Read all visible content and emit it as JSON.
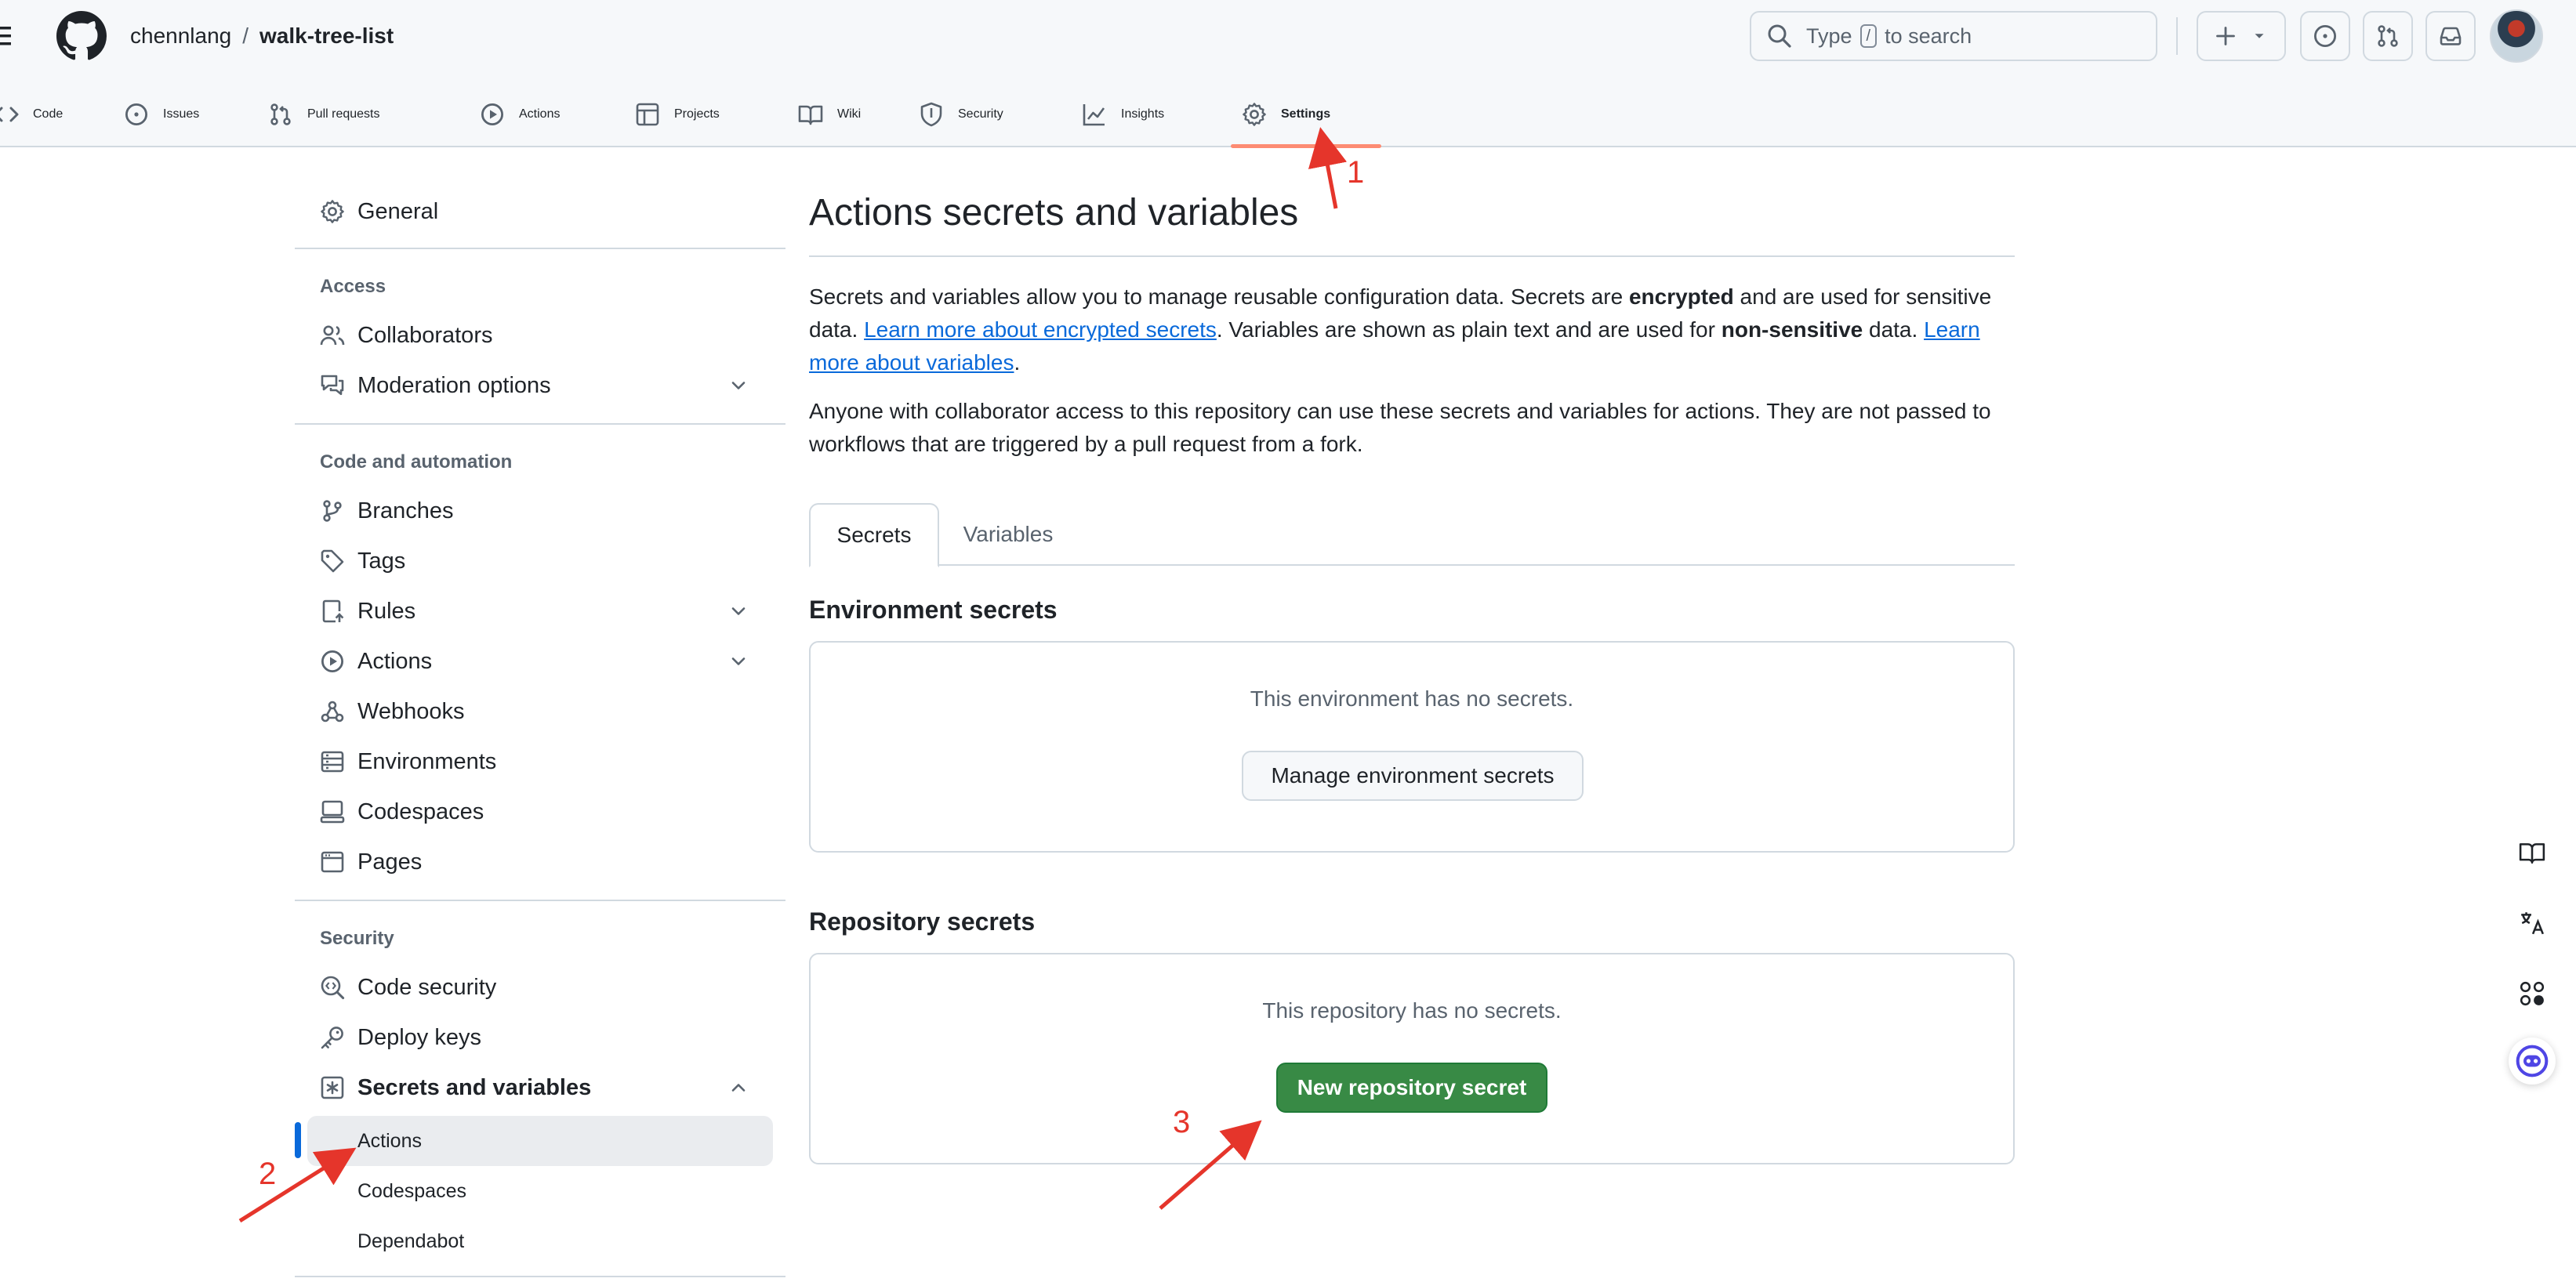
{
  "header": {
    "owner": "chennlang",
    "separator": "/",
    "repo": "walk-tree-list",
    "search": {
      "prefix": "Type",
      "key": "/",
      "suffix": "to search"
    }
  },
  "repo_nav": {
    "items": [
      {
        "label": "Code",
        "icon": "code-icon"
      },
      {
        "label": "Issues",
        "icon": "issue-icon"
      },
      {
        "label": "Pull requests",
        "icon": "pull-request-icon"
      },
      {
        "label": "Actions",
        "icon": "play-icon"
      },
      {
        "label": "Projects",
        "icon": "table-icon"
      },
      {
        "label": "Wiki",
        "icon": "book-icon"
      },
      {
        "label": "Security",
        "icon": "shield-icon"
      },
      {
        "label": "Insights",
        "icon": "graph-icon"
      },
      {
        "label": "Settings",
        "icon": "gear-icon"
      }
    ],
    "active": "Settings"
  },
  "sidebar": {
    "general": "General",
    "access_heading": "Access",
    "collaborators": "Collaborators",
    "moderation": "Moderation options",
    "code_heading": "Code and automation",
    "branches": "Branches",
    "tags": "Tags",
    "rules": "Rules",
    "actions": "Actions",
    "webhooks": "Webhooks",
    "environments": "Environments",
    "codespaces": "Codespaces",
    "pages": "Pages",
    "security_heading": "Security",
    "code_security": "Code security",
    "deploy_keys": "Deploy keys",
    "secrets": "Secrets and variables",
    "sub_actions": "Actions",
    "sub_codespaces": "Codespaces",
    "sub_dependabot": "Dependabot"
  },
  "main": {
    "title": "Actions secrets and variables",
    "p1": {
      "a": "Secrets and variables allow you to manage reusable configuration data. Secrets are ",
      "b": "encrypted",
      "c": " and are used for sensitive data. ",
      "link1": "Learn more about encrypted secrets",
      "d": ". Variables are shown as plain text and are used for ",
      "e": "non-sensitive",
      "f": " data. ",
      "link2": "Learn more about variables",
      "g": "."
    },
    "p2": "Anyone with collaborator access to this repository can use these secrets and variables for actions. They are not passed to workflows that are triggered by a pull request from a fork.",
    "tabs": [
      "Secrets",
      "Variables"
    ],
    "env_title": "Environment secrets",
    "env_msg": "This environment has no secrets.",
    "env_button": "Manage environment secrets",
    "repo_title": "Repository secrets",
    "repo_msg": "This repository has no secrets.",
    "repo_button": "New repository secret"
  },
  "annotations": [
    "1",
    "2",
    "3"
  ],
  "colors": {
    "accent_underline": "#fd8c73",
    "link": "#0969da",
    "primary_button": "#388a45",
    "annotation": "#e5352b"
  }
}
